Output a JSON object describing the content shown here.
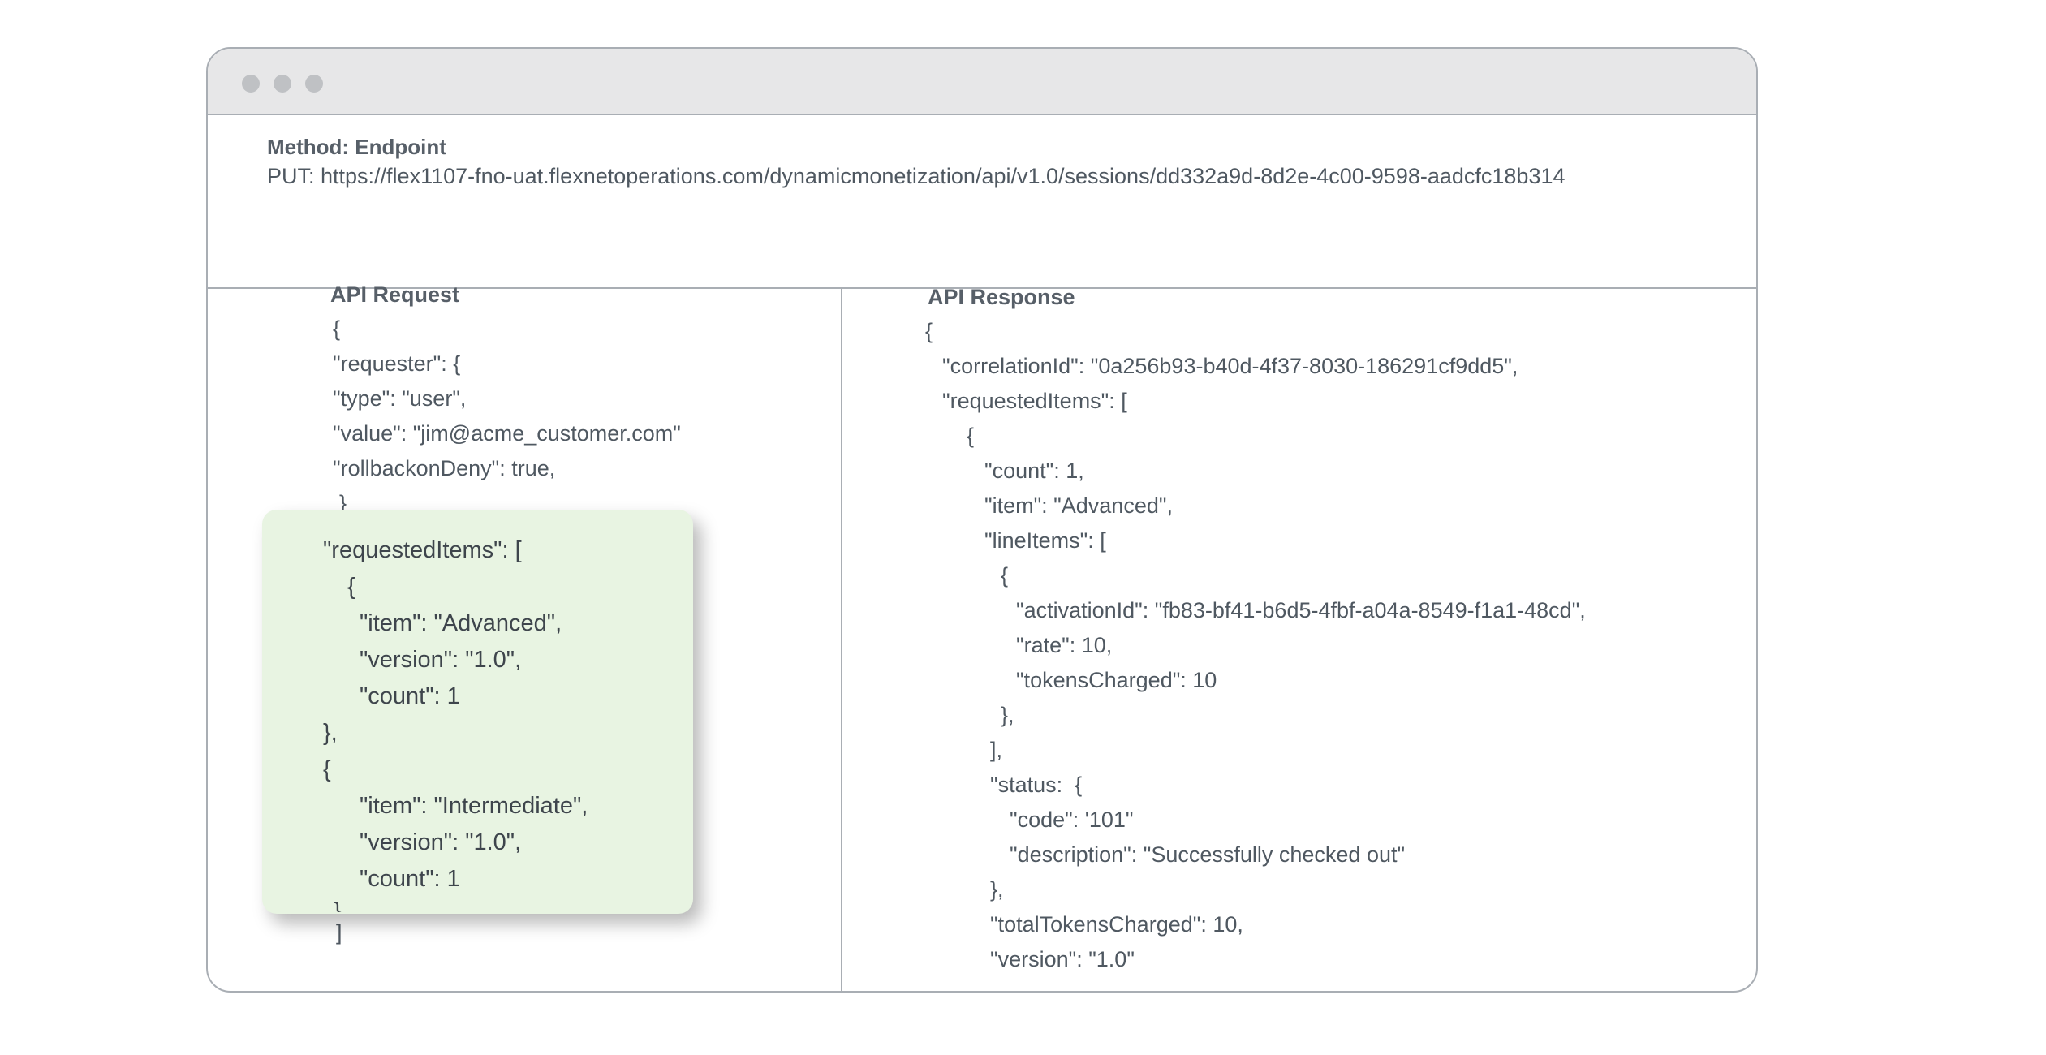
{
  "window": {
    "controls": [
      "close-dot",
      "minimize-dot",
      "maximize-dot"
    ]
  },
  "endpoint": {
    "title": "Method: Endpoint",
    "url": "PUT: https://flex1107-fno-uat.flexnetoperations.com/dynamicmonetization/api/v1.0/sessions/dd332a9d-8d2e-4c00-9598-aadcfc18b314"
  },
  "request": {
    "title": "API Request",
    "lines": [
      "{",
      "\"requester\": {",
      "\"type\": \"user\",",
      "\"value\": \"jim@acme_customer.com\"",
      "\"rollbackonDeny\": true,",
      "}"
    ],
    "trailing": "]",
    "highlight_lines": [
      "\"requestedItems\": [",
      "{",
      "\"item\": \"Advanced\",",
      "\"version\": \"1.0\",",
      "\"count\": 1",
      "},",
      "{",
      "\"item\": \"Intermediate\",",
      "\"version\": \"1.0\",",
      "\"count\": 1",
      "}"
    ]
  },
  "response": {
    "title": "API Response",
    "lines": [
      "{",
      "\"correlationId\": \"0a256b93-b40d-4f37-8030-186291cf9dd5\",",
      "\"requestedItems\": [",
      "{",
      "\"count\": 1,",
      "\"item\": \"Advanced\",",
      "\"lineItems\": [",
      "{",
      "\"activationId\": \"fb83-bf41-b6d5-4fbf-a04a-8549-f1a1-48cd\",",
      "\"rate\": 10,",
      "\"tokensCharged\": 10",
      "},",
      "],",
      "\"status:  {",
      "\"code\": '101\"",
      "\"description\": \"Successfully checked out\"",
      "},",
      "\"totalTokensCharged\": 10,",
      "\"version\": \"1.0\""
    ]
  }
}
